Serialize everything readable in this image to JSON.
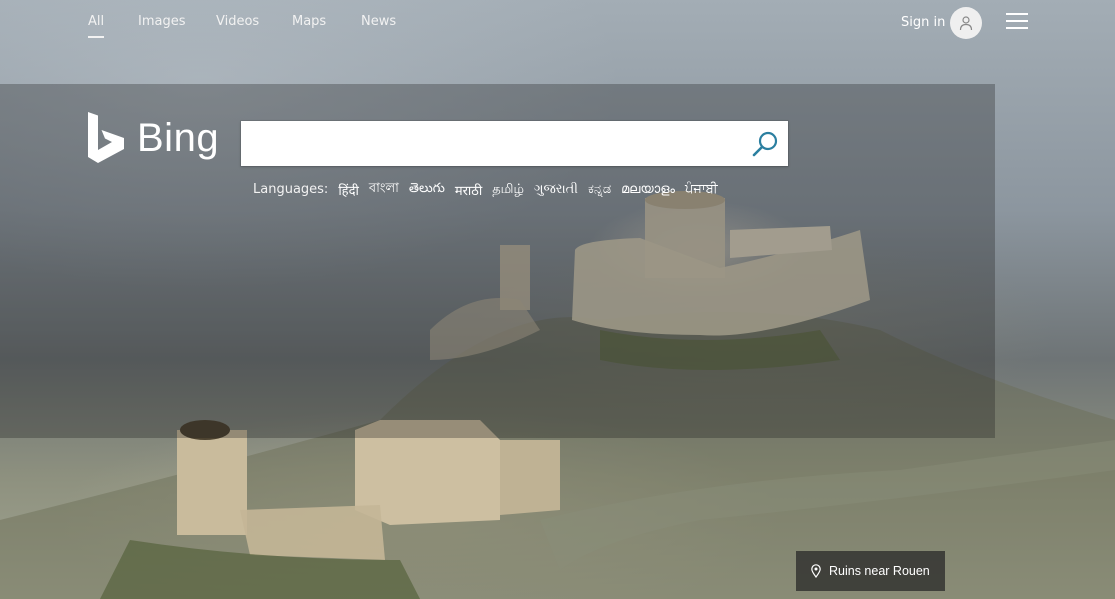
{
  "nav": {
    "items": [
      {
        "label": "All",
        "active": true
      },
      {
        "label": "Images"
      },
      {
        "label": "Videos"
      },
      {
        "label": "Maps"
      },
      {
        "label": "News"
      }
    ],
    "signin_label": "Sign in",
    "avatar_icon": "person-icon",
    "menu_icon": "hamburger-menu-icon"
  },
  "logo": {
    "text": "Bing",
    "icon": "bing-b-logo"
  },
  "search": {
    "value": "",
    "placeholder": "",
    "button_icon": "search-icon",
    "accent": "#2b7fa0"
  },
  "languages": {
    "label": "Languages:",
    "items": [
      "हिंदी",
      "বাংলা",
      "తెలుగు",
      "मराठी",
      "தமிழ்",
      "ગુજરાતી",
      "ಕನ್ನಡ",
      "മലയാളം",
      "ਪੰਜਾਬੀ"
    ]
  },
  "location": {
    "icon": "location-pin-icon",
    "label": "Ruins near Rouen"
  }
}
